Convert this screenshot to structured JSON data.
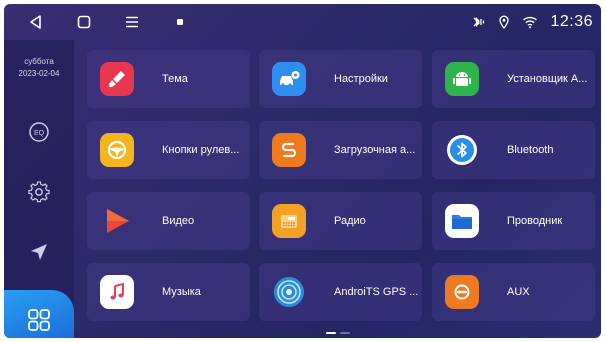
{
  "status": {
    "time": "12:36"
  },
  "sidebar": {
    "day": "суббота",
    "date": "2023-02-04",
    "eq_label": "EQ"
  },
  "apps": [
    {
      "label": "Тема",
      "icon": "theme-brush-icon",
      "color": "#e8374f"
    },
    {
      "label": "Настройки",
      "icon": "car-settings-icon",
      "color": "#2f8ef0"
    },
    {
      "label": "Установщик A...",
      "icon": "android-installer-icon",
      "color": "#2fb34b"
    },
    {
      "label": "Кнопки рулев...",
      "icon": "steering-wheel-icon",
      "color": "#f5b51e"
    },
    {
      "label": "Загрузочная а...",
      "icon": "boot-animation-icon",
      "color": "#f07a1e"
    },
    {
      "label": "Bluetooth",
      "icon": "bluetooth-icon",
      "color": "#2a8fe8"
    },
    {
      "label": "Видео",
      "icon": "video-play-icon",
      "color": "#ee4636"
    },
    {
      "label": "Радио",
      "icon": "radio-icon",
      "color": "#f3a126"
    },
    {
      "label": "Проводник",
      "icon": "folder-icon",
      "color": "#2a7de6"
    },
    {
      "label": "Музыка",
      "icon": "music-note-icon",
      "color": "#ef3d5a"
    },
    {
      "label": "AndroiTS GPS ...",
      "icon": "gps-radar-icon",
      "color": "#2a8ed6"
    },
    {
      "label": "AUX",
      "icon": "aux-icon",
      "color": "#f07a22"
    }
  ]
}
